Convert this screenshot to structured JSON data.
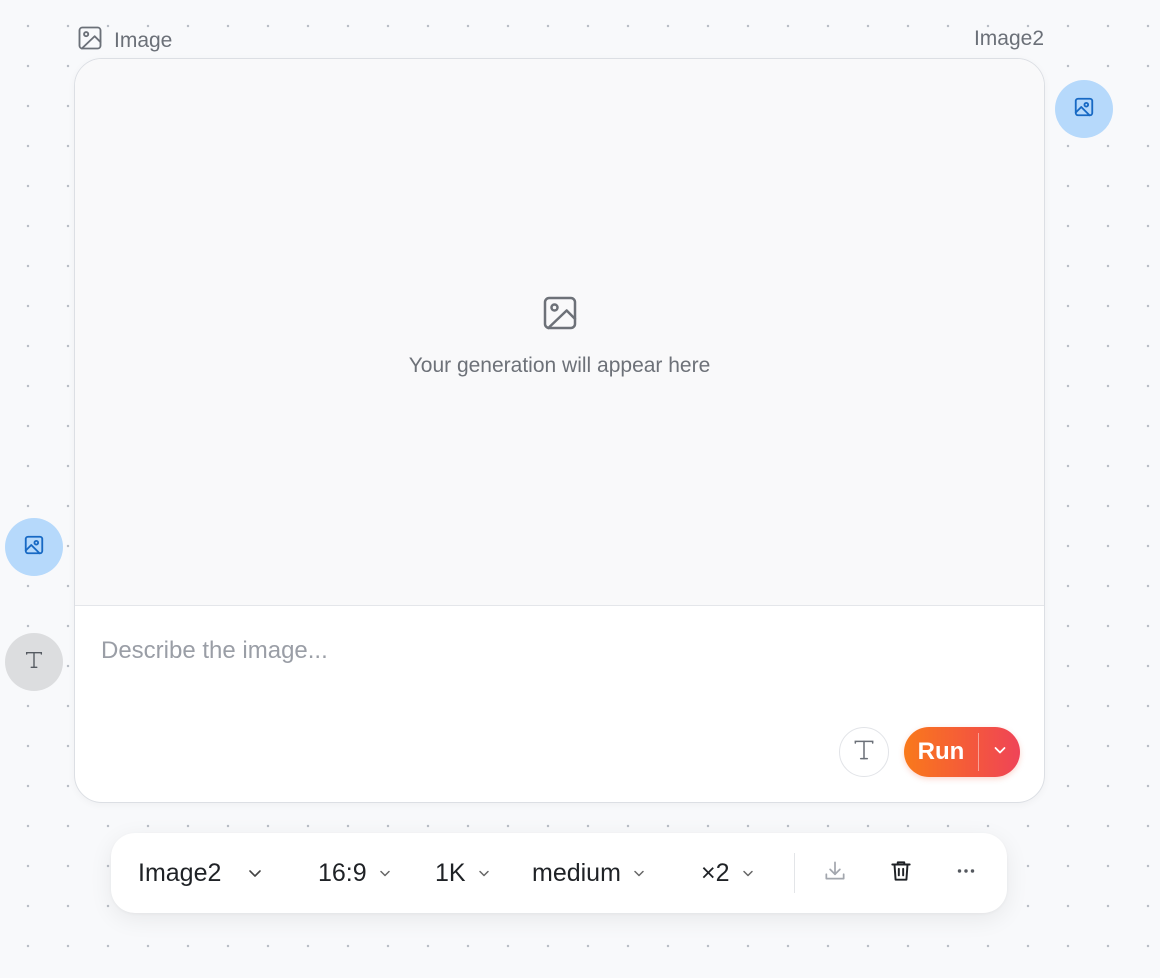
{
  "node": {
    "type_label": "Image",
    "model_label": "Image2",
    "type_icon": "image-icon"
  },
  "preview": {
    "icon": "image-icon",
    "placeholder": "Your generation will appear here"
  },
  "prompt": {
    "value": "",
    "placeholder": "Describe the image..."
  },
  "actions": {
    "text_toggle_icon": "text-t-icon",
    "run_label": "Run",
    "run_menu_icon": "chevron-down-icon"
  },
  "ports": {
    "output_image_icon": "image-icon",
    "input_image_icon": "image-icon",
    "input_text_icon": "text-t-icon"
  },
  "toolbar": {
    "model": "Image2",
    "aspect_ratio": "16:9",
    "resolution": "1K",
    "quality": "medium",
    "count": "×2",
    "download_icon": "download-icon",
    "delete_icon": "trash-icon",
    "more_icon": "more-horizontal-icon"
  },
  "colors": {
    "accent_gradient_start": "#f9791b",
    "accent_gradient_end": "#ef4458",
    "image_port": "#b6d9fb",
    "text_port": "#dcdddf",
    "canvas_bg": "#f8f9fb"
  }
}
